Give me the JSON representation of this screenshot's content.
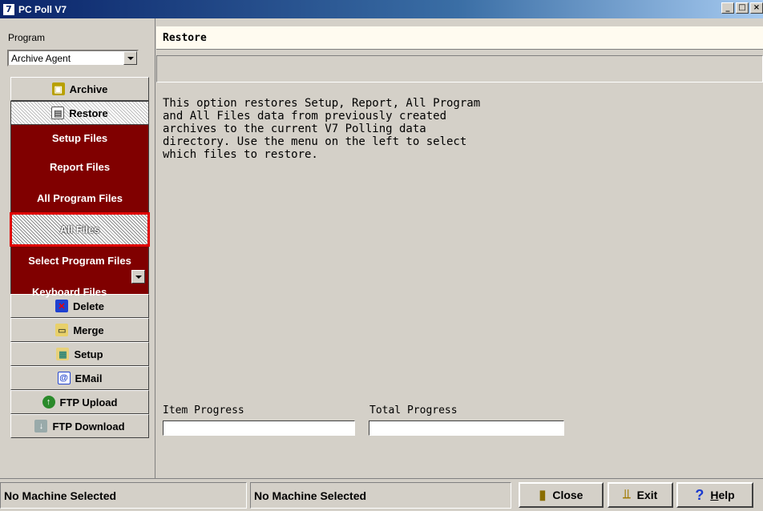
{
  "window": {
    "title": "PC Poll V7",
    "app_icon": "7",
    "buttons": [
      "_",
      "□",
      "×"
    ]
  },
  "sidebar": {
    "program_label": "Program",
    "program_value": "Archive Agent",
    "nav_top": [
      {
        "label": "Archive",
        "icon": "archive-icon"
      },
      {
        "label": "Restore",
        "icon": "restore-icon"
      }
    ],
    "sub_items": [
      "Setup Files",
      "Report Files",
      "All Program Files",
      "All Files",
      "Select Program Files",
      "Keyboard Files"
    ],
    "nav_bottom": [
      {
        "label": "Delete",
        "icon": "delete-icon"
      },
      {
        "label": "Merge",
        "icon": "merge-icon"
      },
      {
        "label": "Setup",
        "icon": "setup-icon"
      },
      {
        "label": "EMail",
        "icon": "email-icon"
      },
      {
        "label": "FTP Upload",
        "icon": "ftp-upload-icon"
      },
      {
        "label": "FTP Download",
        "icon": "ftp-download-icon"
      }
    ]
  },
  "main": {
    "header": "Restore",
    "description": "This option restores Setup, Report, All Program and All Files data from previously created archives to the current V7 Polling data directory. Use the menu on the left to select which files to restore.",
    "item_progress_label": "Item Progress",
    "total_progress_label": "Total Progress",
    "item_progress": 0,
    "total_progress": 0
  },
  "status": {
    "left": "No Machine Selected",
    "middle": "No Machine Selected",
    "close_label": "Close",
    "exit_label": "Exit",
    "help_prefix": "H",
    "help_rest": "elp"
  },
  "colors": {
    "sub_panel": "#800000",
    "selection_outline": "#e00000",
    "title_gradient": "#0a246a"
  }
}
